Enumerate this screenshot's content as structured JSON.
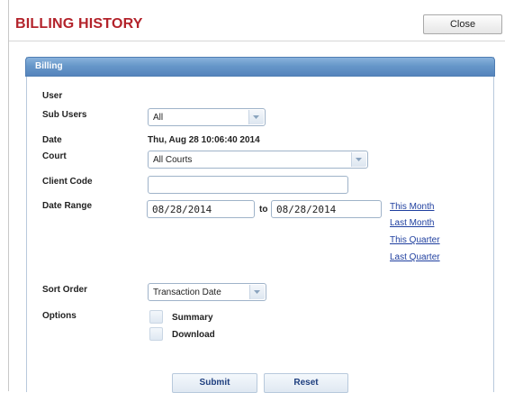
{
  "header": {
    "title": "BILLING HISTORY",
    "close_label": "Close"
  },
  "panel": {
    "title": "Billing"
  },
  "form": {
    "user_label": "User",
    "sub_users_label": "Sub Users",
    "sub_users_value": "All",
    "date_label": "Date",
    "date_value": "Thu, Aug 28 10:06:40 2014",
    "court_label": "Court",
    "court_value": "All Courts",
    "client_code_label": "Client Code",
    "client_code_value": "",
    "date_range_label": "Date Range",
    "date_from": "08/28/2014",
    "to_label": "to",
    "date_to": "08/28/2014",
    "quick_ranges": [
      "This Month",
      "Last Month",
      "This Quarter",
      "Last Quarter"
    ],
    "sort_order_label": "Sort Order",
    "sort_order_value": "Transaction Date",
    "options_label": "Options",
    "options": [
      {
        "label": "Summary",
        "checked": false
      },
      {
        "label": "Download",
        "checked": false
      }
    ]
  },
  "actions": {
    "submit_label": "Submit",
    "reset_label": "Reset"
  },
  "colors": {
    "title": "#b3232b",
    "panel_header": "#6797c9",
    "link": "#1f3f9f"
  }
}
